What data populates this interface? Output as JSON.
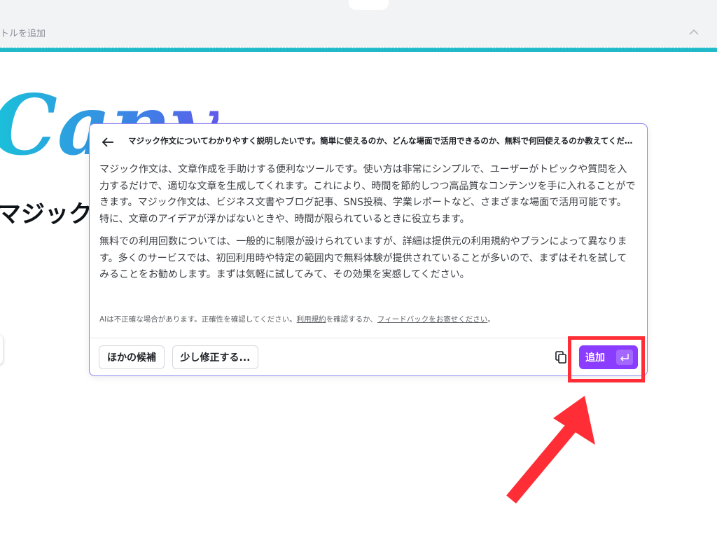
{
  "topbar": {
    "title_hint": "トルを追加",
    "collapse_icon": "chevron-up-icon"
  },
  "colors": {
    "accent_teal": "#1fbac9",
    "brand_purple": "#8b3dff",
    "popup_border": "#8b84f0",
    "highlight_red": "#ff2e36"
  },
  "background": {
    "logo_text": "Canva",
    "heading": "マジック"
  },
  "popup": {
    "prompt": "マジック作文についてわかりやすく説明したいです。簡単に使えるのか、どんな場面で活用できるのか、無料で何回使えるのか教えてください。",
    "paragraphs": [
      "マジック作文は、文章作成を手助けする便利なツールです。使い方は非常にシンプルで、ユーザーがトピックや質問を入力するだけで、適切な文章を生成してくれます。これにより、時間を節約しつつ高品質なコンテンツを手に入れることができます。マジック作文は、ビジネス文書やブログ記事、SNS投稿、学業レポートなど、さまざまな場面で活用可能です。特に、文章のアイデアが浮かばないときや、時間が限られているときに役立ちます。",
      "無料での利用回数については、一般的に制限が設けられていますが、詳細は提供元の利用規約やプランによって異なります。多くのサービスでは、初回利用時や特定の範囲内で無料体験が提供されていることが多いので、まずはそれを試してみることをお勧めします。まずは気軽に試してみて、その効果を実感してください。"
    ],
    "disclaimer": {
      "part1": "AIは不正確な場合があります。正確性を確認してください。",
      "terms_link": "利用規約",
      "part2": "を確認するか、",
      "feedback_link": "フィードバックをお寄せください",
      "part3": "。"
    },
    "buttons": {
      "other_candidates": "ほかの候補",
      "modify": "少し修正する...",
      "add": "追加"
    },
    "icons": {
      "back": "arrow-left-icon",
      "copy": "copy-icon",
      "enter": "enter-key-icon"
    }
  }
}
